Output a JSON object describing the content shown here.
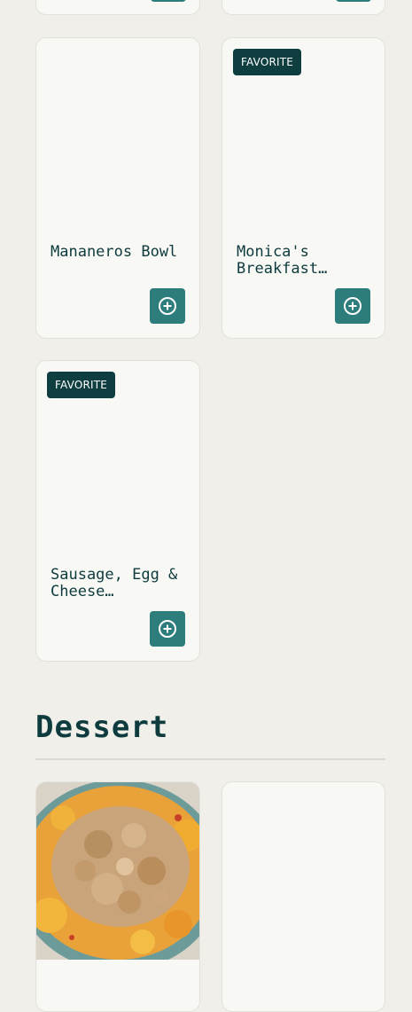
{
  "badges": {
    "favorite": "FAVORITE"
  },
  "cards": {
    "mananeros_bowl": {
      "title": "Mananeros Bowl"
    },
    "monicas_breakfast": {
      "title": "Monica's Breakfast…"
    },
    "sausage_egg_cheese": {
      "title": "Sausage, Egg & Cheese…"
    }
  },
  "sections": {
    "dessert": {
      "title": "Dessert"
    }
  },
  "icons": {
    "add": "plus-circle-icon"
  },
  "colors": {
    "button": "#2e7d7d",
    "badge": "#0f3e40",
    "text": "#0e3b3d",
    "background": "#f0efea"
  }
}
